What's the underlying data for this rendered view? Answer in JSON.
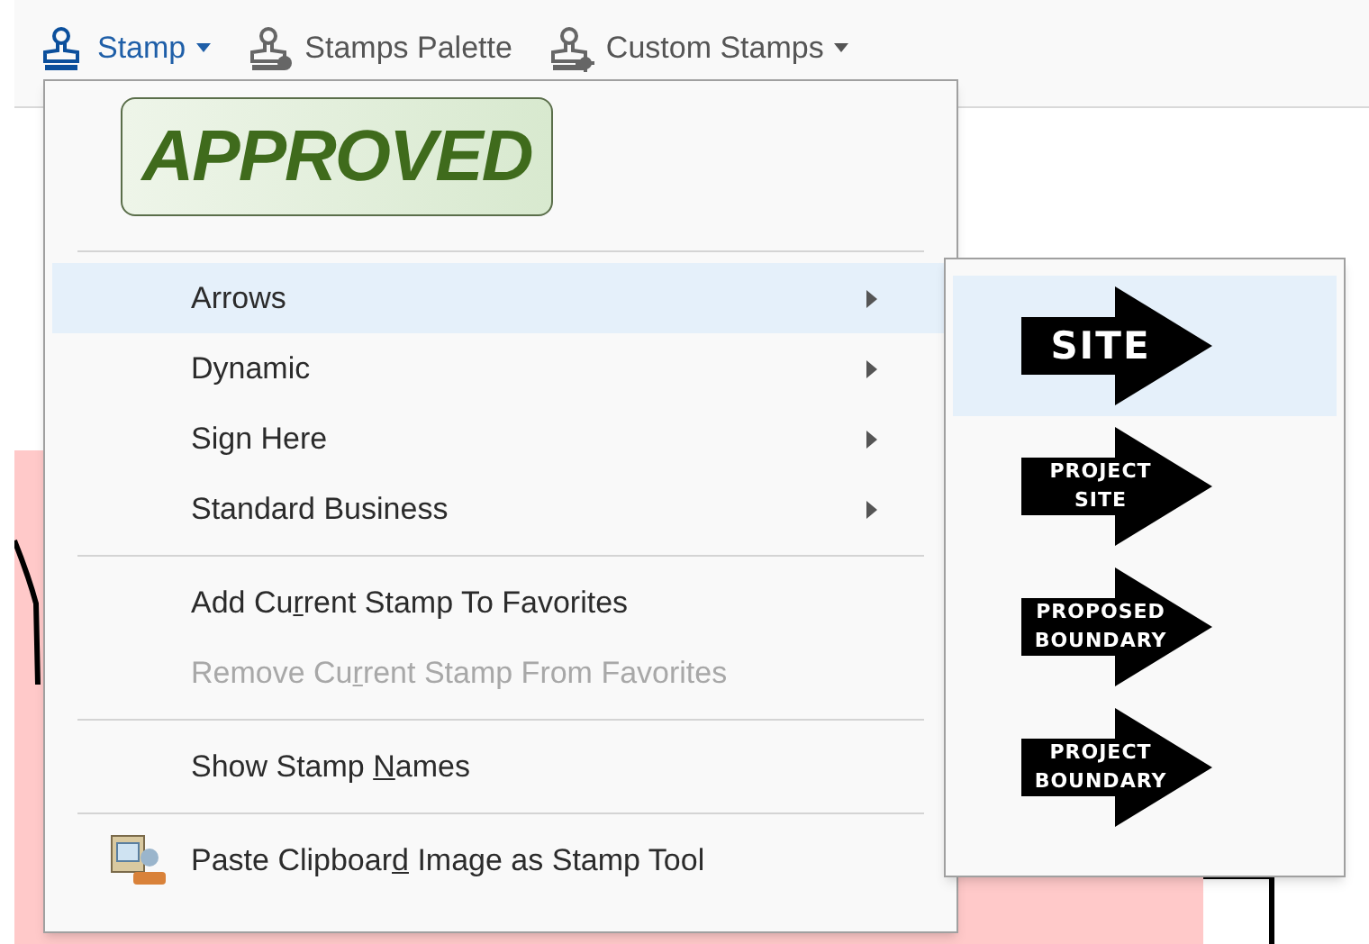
{
  "toolbar": [
    {
      "kind": "stamp",
      "label": "Stamp",
      "dropdown": true,
      "open": true
    },
    {
      "kind": "palette",
      "label": "Stamps Palette",
      "dropdown": false,
      "open": false
    },
    {
      "kind": "custom",
      "label": "Custom Stamps",
      "dropdown": true,
      "open": false
    }
  ],
  "favorite_stamp": {
    "label": "APPROVED"
  },
  "menu": [
    {
      "kind": "separator"
    },
    {
      "kind": "submenu",
      "label": "Arrows",
      "selected": true,
      "disabled": false
    },
    {
      "kind": "submenu",
      "label": "Dynamic",
      "selected": false,
      "disabled": false
    },
    {
      "kind": "submenu",
      "label": "Sign Here",
      "selected": false,
      "disabled": false
    },
    {
      "kind": "submenu",
      "label": "Standard Business",
      "selected": false,
      "disabled": false
    },
    {
      "kind": "separator"
    },
    {
      "kind": "command",
      "label_before": "Add Cu",
      "access_key": "r",
      "label_after": "rent Stamp To Favorites",
      "selected": false,
      "disabled": false
    },
    {
      "kind": "command",
      "label_before": "Remove Cu",
      "access_key": "r",
      "label_after": "rent Stamp From Favorites",
      "selected": false,
      "disabled": true
    },
    {
      "kind": "separator"
    },
    {
      "kind": "command",
      "label_before": "Show Stamp ",
      "access_key": "N",
      "label_after": "ames",
      "selected": false,
      "disabled": false
    },
    {
      "kind": "separator"
    },
    {
      "kind": "paste",
      "label_before": "Paste Clipboar",
      "access_key": "d",
      "label_after": " Image as Stamp Tool",
      "selected": false,
      "disabled": false
    }
  ],
  "submenu": [
    {
      "lines": [
        "SITE"
      ],
      "selected": true
    },
    {
      "lines": [
        "PROJECT",
        "SITE"
      ],
      "selected": false
    },
    {
      "lines": [
        "PROPOSED",
        "BOUNDARY"
      ],
      "selected": false
    },
    {
      "lines": [
        "PROJECT",
        "BOUNDARY"
      ],
      "selected": false
    }
  ]
}
